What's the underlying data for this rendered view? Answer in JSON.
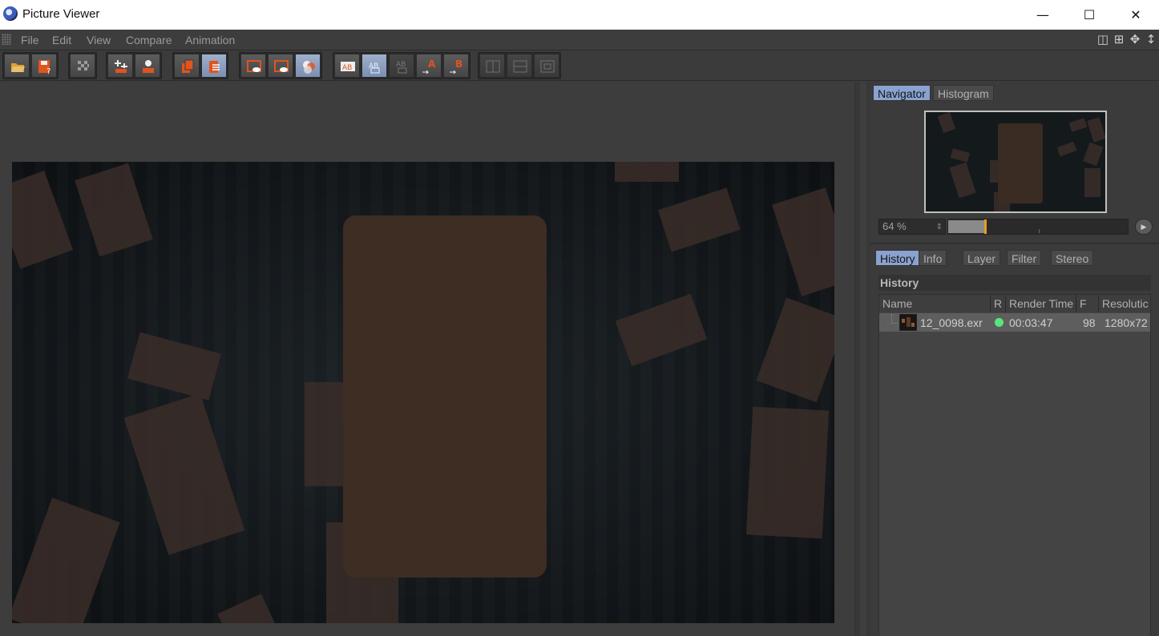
{
  "window": {
    "title": "Picture Viewer",
    "minimize": "—",
    "maximize": "☐",
    "close": "✕"
  },
  "menu": [
    "File",
    "Edit",
    "View",
    "Compare",
    "Animation"
  ],
  "navigator": {
    "tabs": [
      "Navigator",
      "Histogram"
    ],
    "active_tab": "Navigator",
    "zoom_value": "64 %",
    "zoom_fraction": 0.64
  },
  "panel_tabs": [
    "History",
    "Info",
    "Layer",
    "Filter",
    "Stereo"
  ],
  "history": {
    "title": "History",
    "columns": [
      "Name",
      "R",
      "Render Time",
      "F",
      "Resolutic"
    ],
    "rows": [
      {
        "name": "12_0098.exr",
        "status_color": "#56e87a",
        "render_time": "00:03:47",
        "frame": "98",
        "resolution": "1280x72"
      }
    ]
  },
  "colors": {
    "accent": "#8aa2cf",
    "toolbar_orange": "#e0541e",
    "status_ok": "#56e87a"
  }
}
